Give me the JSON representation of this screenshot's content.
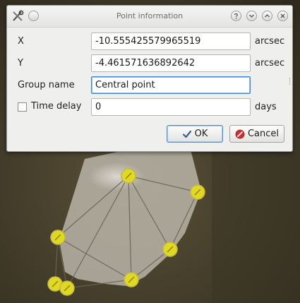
{
  "window": {
    "title": "Point information"
  },
  "fields": {
    "x": {
      "label": "X",
      "value": "-10.555425579965519",
      "unit": "arcsec"
    },
    "y": {
      "label": "Y",
      "value": "-4.461571636892642",
      "unit": "arcsec"
    },
    "group_name": {
      "label": "Group name",
      "value": "Central point"
    },
    "time_delay": {
      "label": "Time delay",
      "value": "0",
      "unit": "days",
      "checked": false
    }
  },
  "buttons": {
    "ok_label": "OK",
    "cancel_label": "Cancel"
  },
  "icons": {
    "app": "tools-icon",
    "minimize": "chevron-down-icon",
    "maximize": "chevron-up-icon",
    "close": "close-icon",
    "help": "help-icon",
    "ok": "checkmark-icon",
    "cancel": "cancel-icon"
  },
  "colors": {
    "point_marker": "#e1d820",
    "field_focus": "#3e8ad9",
    "cancel_icon": "#d22c2c"
  }
}
